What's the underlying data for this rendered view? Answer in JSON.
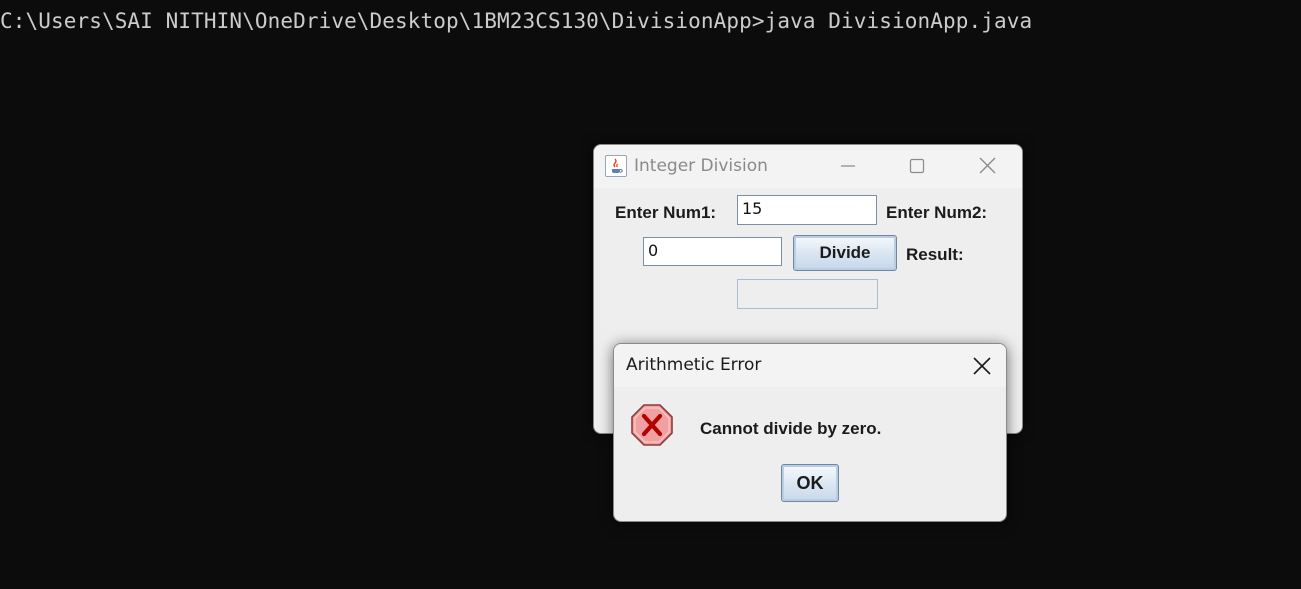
{
  "console": {
    "command_line": "C:\\Users\\SAI NITHIN\\OneDrive\\Desktop\\1BM23CS130\\DivisionApp>java DivisionApp.java"
  },
  "main_window": {
    "title": "Integer Division",
    "num1_label": "Enter Num1:",
    "num1_value": "15",
    "num2_label": "Enter Num2:",
    "num2_value": "0",
    "divide_button": "Divide",
    "result_label": "Result:",
    "result_value": ""
  },
  "error_dialog": {
    "title": "Arithmetic Error",
    "icon": "error-icon",
    "message": "Cannot divide by zero.",
    "ok_button": "OK"
  },
  "colors": {
    "console_background": "#0c0c0c",
    "console_text": "#cccccc",
    "window_background": "#eeeeee",
    "error_icon_fill": "#f0a0a0",
    "error_icon_mark": "#b30000"
  }
}
